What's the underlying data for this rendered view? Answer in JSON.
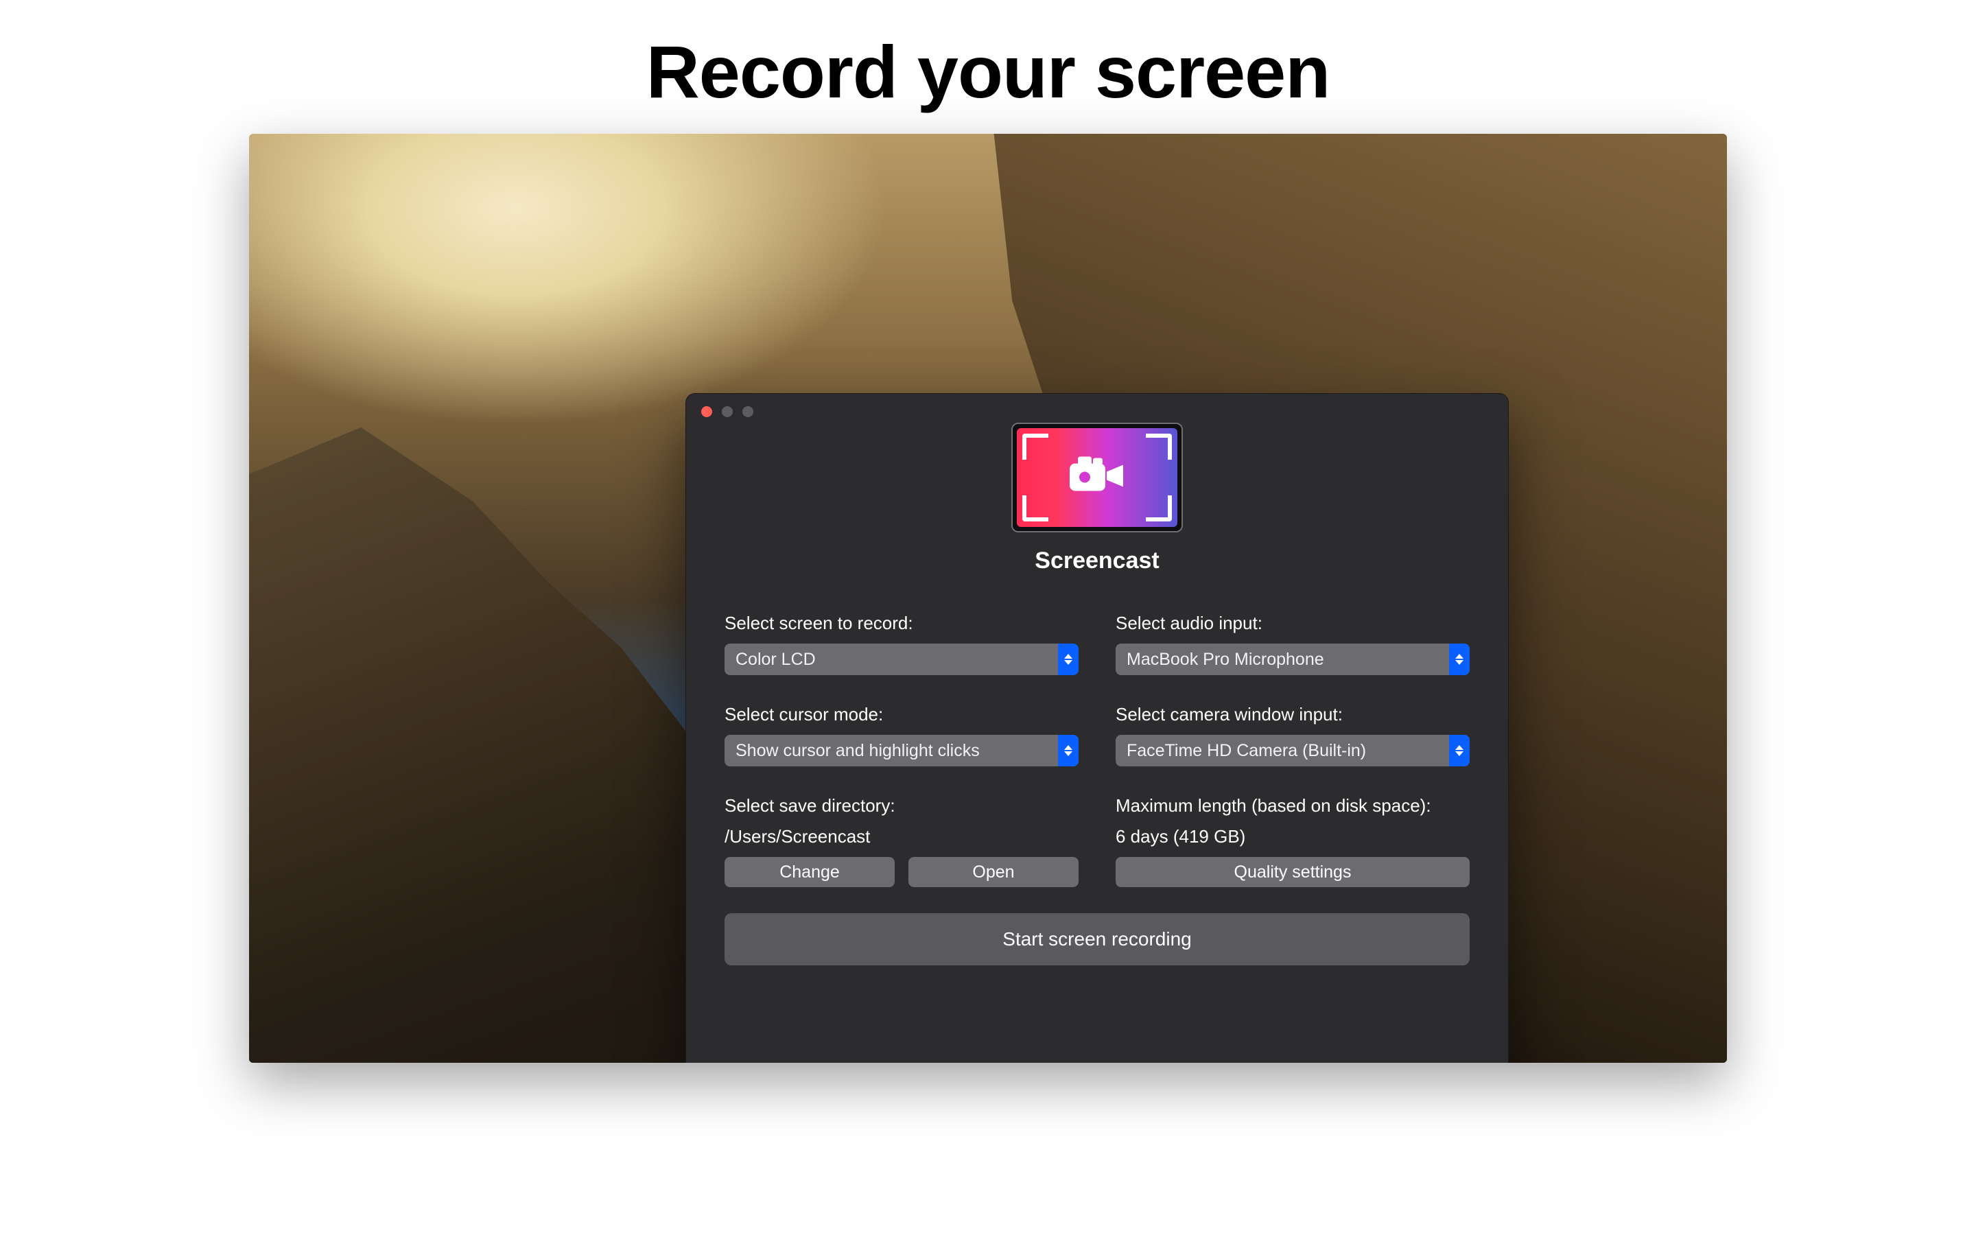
{
  "marketing": {
    "headline": "Record your screen"
  },
  "window": {
    "app_name": "Screencast",
    "traffic": {
      "close": "close",
      "min": "minimize",
      "zoom": "zoom"
    }
  },
  "form": {
    "screen": {
      "label": "Select screen to record:",
      "value": "Color LCD"
    },
    "audio": {
      "label": "Select audio input:",
      "value": "MacBook Pro Microphone"
    },
    "cursor": {
      "label": "Select cursor mode:",
      "value": "Show cursor and highlight clicks"
    },
    "camera": {
      "label": "Select camera window input:",
      "value": "FaceTime HD Camera (Built-in)"
    },
    "save": {
      "label": "Select save directory:",
      "path": "/Users/Screencast",
      "change": "Change",
      "open": "Open"
    },
    "maxlen": {
      "label": "Maximum length (based on disk space):",
      "value": "6 days (419 GB)",
      "quality": "Quality settings"
    },
    "start": "Start screen recording"
  }
}
